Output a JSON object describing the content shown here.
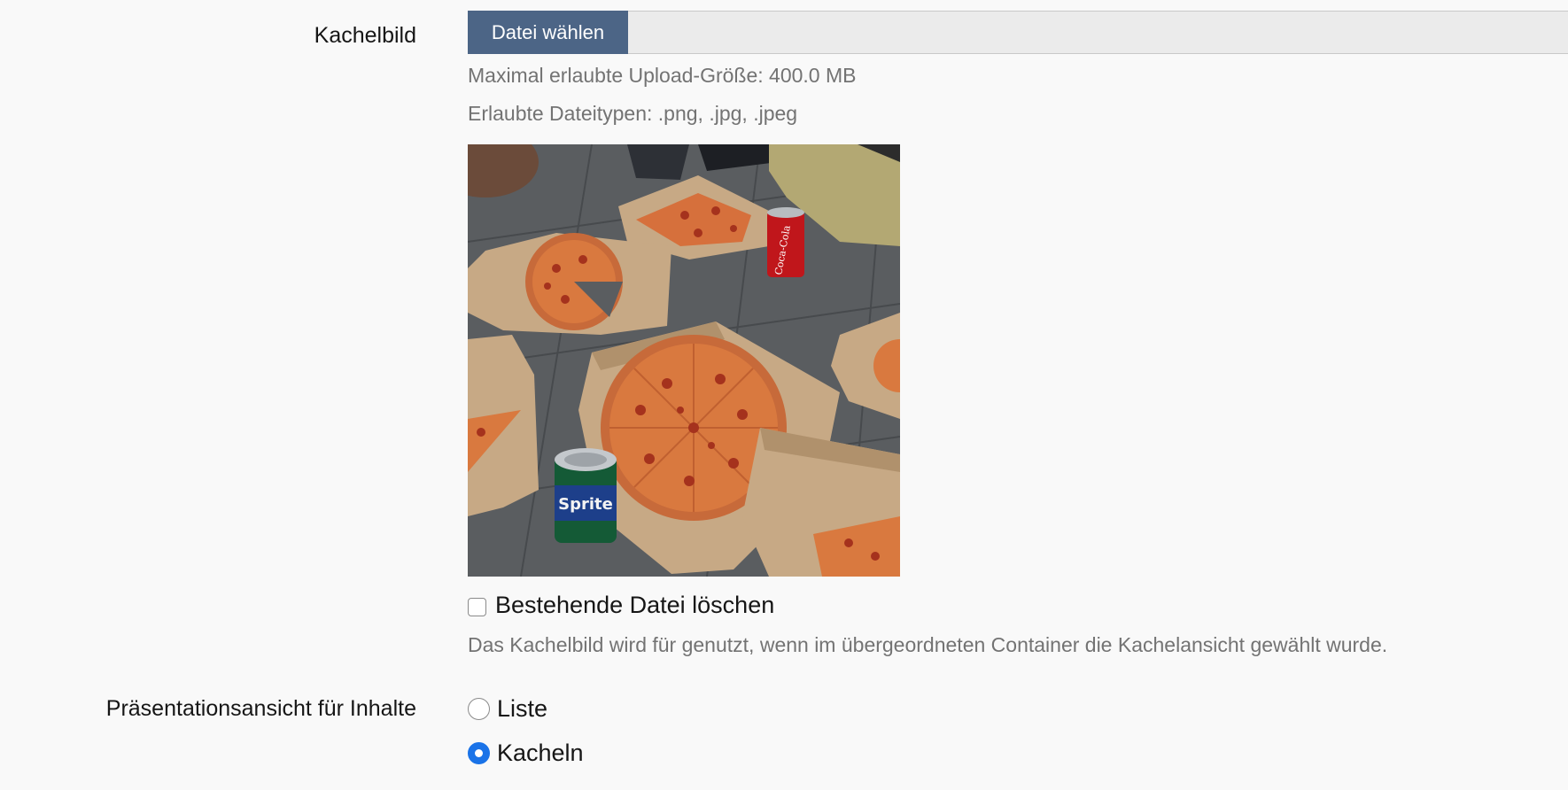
{
  "tile_image": {
    "label": "Kachelbild",
    "choose_file_button": "Datei wählen",
    "max_upload_size": "Maximal erlaubte Upload-Größe: 400.0 MB",
    "allowed_types": "Erlaubte Dateitypen: .png, .jpg, .jpeg",
    "delete_existing_label": "Bestehende Datei löschen",
    "delete_existing_checked": false,
    "byline": "Das Kachelbild wird für genutzt, wenn im übergeordneten Container die Kachelansicht gewählt wurde.",
    "can_red_label": "Coca-Cola",
    "can_green_label": "Sprite"
  },
  "presentation_view": {
    "label": "Präsentationsansicht für Inhalte",
    "options": [
      {
        "label": "Liste",
        "selected": false
      },
      {
        "label": "Kacheln",
        "selected": true
      }
    ]
  },
  "colors": {
    "button_bg": "#4c6586",
    "radio_selected": "#1a73e8",
    "help_text": "#737373"
  }
}
